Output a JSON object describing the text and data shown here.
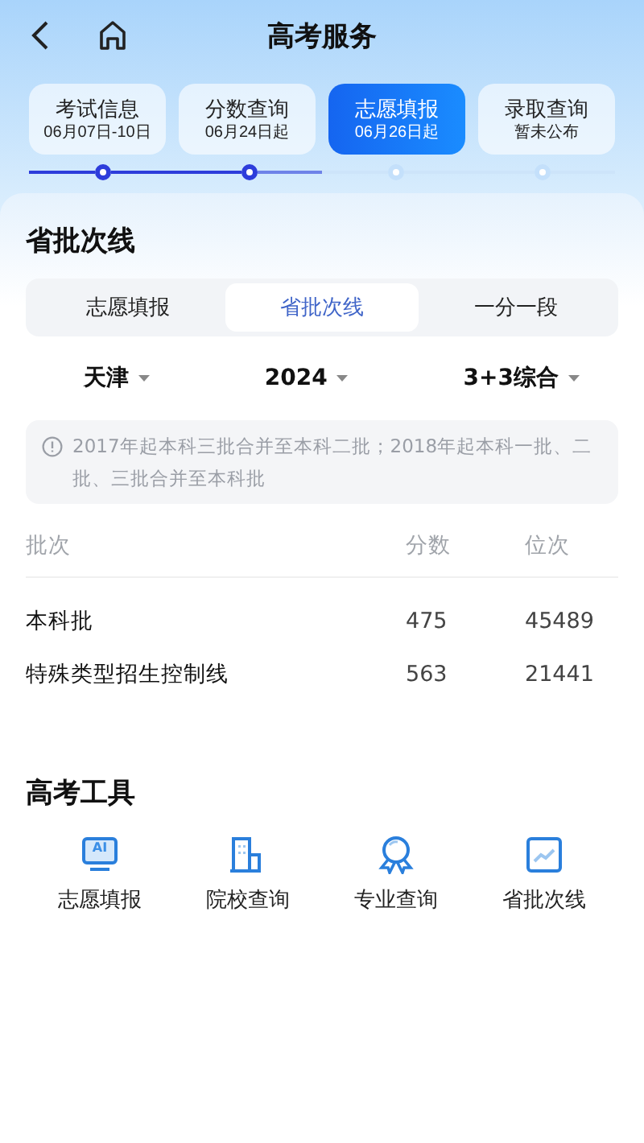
{
  "header": {
    "title": "高考服务"
  },
  "stages": [
    {
      "name": "考试信息",
      "date": "06月07日-10日",
      "selected": false,
      "reached": true
    },
    {
      "name": "分数查询",
      "date": "06月24日起",
      "selected": false,
      "reached": true
    },
    {
      "name": "志愿填报",
      "date": "06月26日起",
      "selected": true,
      "reached": false
    },
    {
      "name": "录取查询",
      "date": "暂未公布",
      "selected": false,
      "reached": false
    }
  ],
  "section_title": "省批次线",
  "segments": [
    {
      "label": "志愿填报",
      "selected": false
    },
    {
      "label": "省批次线",
      "selected": true
    },
    {
      "label": "一分一段",
      "selected": false
    }
  ],
  "filters": [
    "天津",
    "2024",
    "3+3综合"
  ],
  "notice": "2017年起本科三批合并至本科二批；2018年起本科一批、二批、三批合并至本科批",
  "table": {
    "columns": [
      "批次",
      "分数",
      "位次"
    ],
    "rows": [
      [
        "本科批",
        "475",
        "45489"
      ],
      [
        "特殊类型招生控制线",
        "563",
        "21441"
      ]
    ]
  },
  "tools": {
    "title": "高考工具",
    "items": [
      {
        "kind": "ai",
        "label": "志愿填报",
        "icon_text": "AI"
      },
      {
        "kind": "school",
        "label": "院校查询"
      },
      {
        "kind": "major",
        "label": "专业查询"
      },
      {
        "kind": "line",
        "label": "省批次线"
      }
    ]
  }
}
